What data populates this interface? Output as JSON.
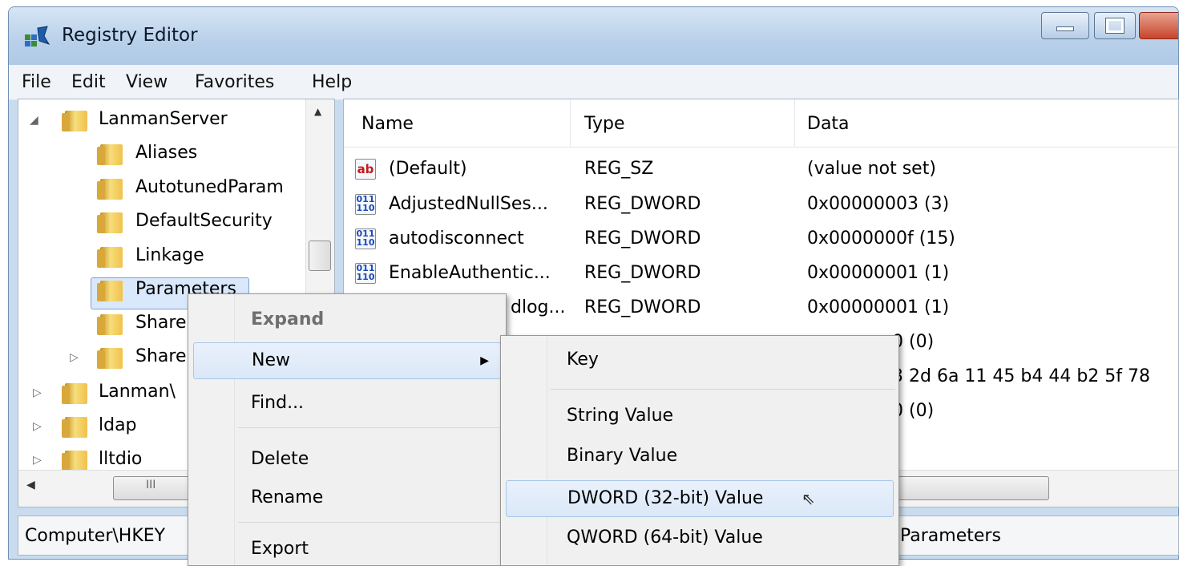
{
  "window": {
    "title": "Registry Editor"
  },
  "menubar": [
    "File",
    "Edit",
    "View",
    "Favorites",
    "Help"
  ],
  "tree": {
    "items": [
      {
        "label": "LanmanServer",
        "expander": "◢"
      },
      {
        "label": "Aliases",
        "expander": ""
      },
      {
        "label": "AutotunedParam",
        "expander": ""
      },
      {
        "label": "DefaultSecurity",
        "expander": ""
      },
      {
        "label": "Linkage",
        "expander": ""
      },
      {
        "label": "Parameters",
        "expander": ""
      },
      {
        "label": "Share",
        "expander": ""
      },
      {
        "label": "Share",
        "expander": "▷"
      },
      {
        "label": "Lanman\\",
        "expander": "▷"
      },
      {
        "label": "ldap",
        "expander": "▷"
      },
      {
        "label": "lltdio",
        "expander": "▷"
      }
    ],
    "scroll_up_icon": "▲",
    "scroll_left_icon": "◀",
    "grip": "III"
  },
  "list": {
    "headers": [
      "Name",
      "Type",
      "Data"
    ],
    "rows": [
      {
        "icon": "ab",
        "name": "(Default)",
        "type": "REG_SZ",
        "data": "(value not set)"
      },
      {
        "icon": "011 110",
        "name": "AdjustedNullSes...",
        "type": "REG_DWORD",
        "data": "0x00000003 (3)"
      },
      {
        "icon": "011 110",
        "name": "autodisconnect",
        "type": "REG_DWORD",
        "data": "0x0000000f (15)"
      },
      {
        "icon": "011 110",
        "name": "EnableAuthentic...",
        "type": "REG_DWORD",
        "data": "0x00000001 (1)"
      },
      {
        "icon": "",
        "name": "dlog...",
        "type": "REG_DWORD",
        "data": "0x00000001 (1)"
      },
      {
        "icon": "",
        "name": "",
        "type": "",
        "data": "0 (0)"
      },
      {
        "icon": "",
        "name": "",
        "type": "",
        "data": "3 2d 6a 11 45 b4 44 b2 5f 78"
      },
      {
        "icon": "",
        "name": "",
        "type": "",
        "data": "0 (0)"
      }
    ]
  },
  "status": {
    "path_start": "Computer\\HKEY",
    "path_end": "Parameters"
  },
  "context_menu": {
    "items": [
      "Expand",
      "New",
      "Find...",
      "Delete",
      "Rename",
      "Export"
    ],
    "submenu_arrow": "▶"
  },
  "submenu": {
    "items": [
      "Key",
      "String Value",
      "Binary Value",
      "DWORD (32-bit) Value",
      "QWORD (64-bit) Value"
    ]
  },
  "cursor": "⇖"
}
